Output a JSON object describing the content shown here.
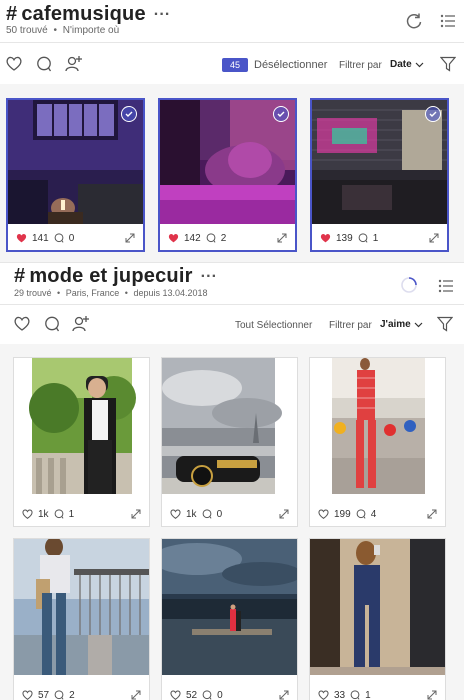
{
  "section1": {
    "hashtag": "#",
    "title": "cafemusique",
    "more": "···",
    "count": "50 trouvé",
    "location": "N'importe où",
    "selected_count": "45",
    "deselect_label": "Désélectionner",
    "filter_label": "Filtrer par",
    "filter_value": "Date",
    "cards": [
      {
        "likes": "141",
        "comments": "0"
      },
      {
        "likes": "142",
        "comments": "2"
      },
      {
        "likes": "139",
        "comments": "1"
      }
    ]
  },
  "section2": {
    "hashtag": "#",
    "title": "mode et jupecuir",
    "more": "···",
    "count": "29 trouvé",
    "location": "Paris, France",
    "since": "depuis 13.04.2018",
    "select_all_label": "Tout Sélectionner",
    "filter_label": "Filtrer par",
    "filter_value": "J'aime",
    "cards": [
      {
        "likes": "1k",
        "comments": "1"
      },
      {
        "likes": "1k",
        "comments": "0"
      },
      {
        "likes": "199",
        "comments": "4"
      },
      {
        "likes": "57",
        "comments": "2"
      },
      {
        "likes": "52",
        "comments": "0"
      },
      {
        "likes": "33",
        "comments": "1"
      }
    ]
  },
  "colors": {
    "accent": "#4a55c8",
    "heart": "#e0344b"
  }
}
